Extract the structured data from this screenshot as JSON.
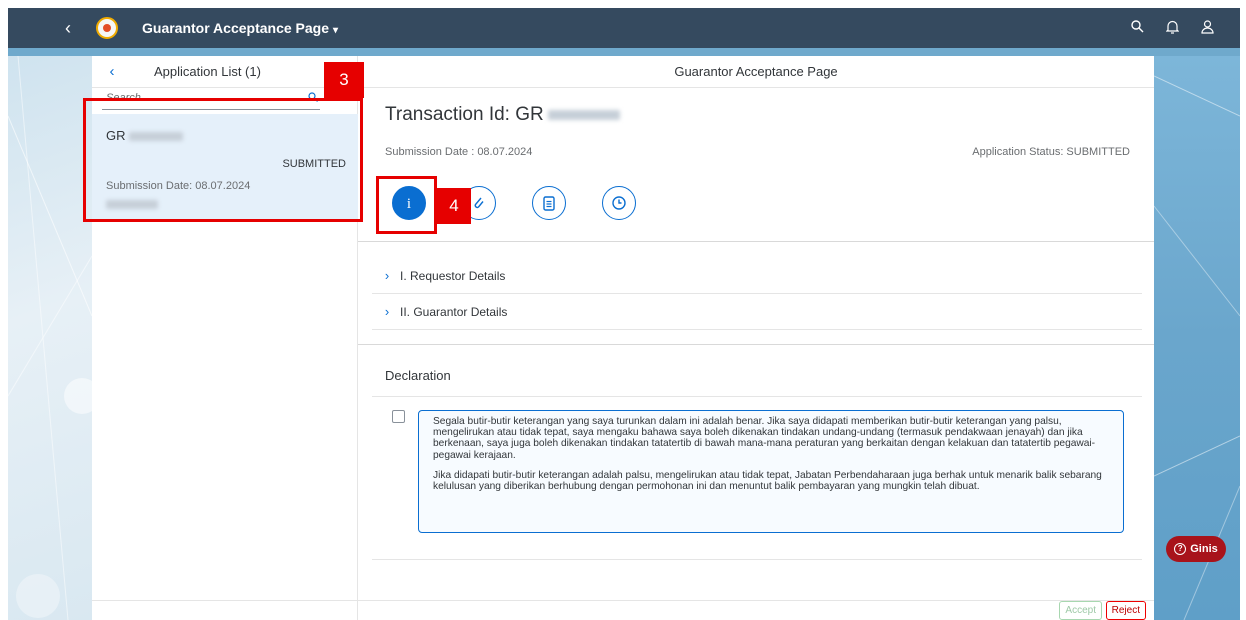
{
  "shell": {
    "back_icon": "chevron-left-icon",
    "title": "Guarantor Acceptance Page",
    "title_caret": "▾",
    "search_icon": "search-icon",
    "bell_icon": "bell-icon",
    "user_icon": "user-icon"
  },
  "master": {
    "title": "Application List (1)",
    "search_placeholder": "Search",
    "items": [
      {
        "id_prefix": "GR",
        "status": "SUBMITTED",
        "submission_date": "Submission Date: 08.07.2024"
      }
    ]
  },
  "detail": {
    "header": "Guarantor Acceptance Page",
    "transaction_label": "Transaction Id: GR",
    "submission_date": "Submission Date : 08.07.2024",
    "application_status": "Application Status: SUBMITTED",
    "tabs": [
      {
        "icon": "info-icon",
        "selected": true
      },
      {
        "icon": "paperclip-icon",
        "selected": false
      },
      {
        "icon": "clipboard-icon",
        "selected": false
      },
      {
        "icon": "clock-icon",
        "selected": false
      }
    ],
    "sections": [
      {
        "label": "I. Requestor Details"
      },
      {
        "label": "II. Guarantor Details"
      }
    ],
    "declaration": {
      "title": "Declaration",
      "checked": false,
      "para1": "Segala butir-butir keterangan yang saya turunkan dalam ini adalah benar. Jika saya didapati memberikan butir-butir keterangan yang palsu, mengelirukan atau tidak tepat, saya mengaku bahawa saya boleh dikenakan tindakan undang-undang (termasuk pendakwaan jenayah) dan jika berkenaan, saya juga boleh dikenakan tindakan tatatertib di bawah mana-mana peraturan yang berkaitan dengan kelakuan dan tatatertib pegawai-pegawai kerajaan.",
      "para2": "Jika didapati butir-butir keterangan adalah palsu, mengelirukan atau tidak tepat, Jabatan Perbendaharaan juga berhak untuk menarik balik sebarang kelulusan yang diberikan berhubung dengan permohonan ini dan menuntut balik pembayaran yang mungkin telah dibuat."
    },
    "buttons": {
      "accept": "Accept",
      "reject": "Reject"
    }
  },
  "callouts": {
    "step3": "3",
    "step4": "4"
  },
  "ginis": {
    "label": "Ginis",
    "icon": "question-circle-icon"
  },
  "colors": {
    "shell": "#354a5f",
    "accent": "#0a6ed1",
    "callout": "#e60000",
    "ginis": "#a8131b",
    "selected_item": "#e5f0fa"
  }
}
